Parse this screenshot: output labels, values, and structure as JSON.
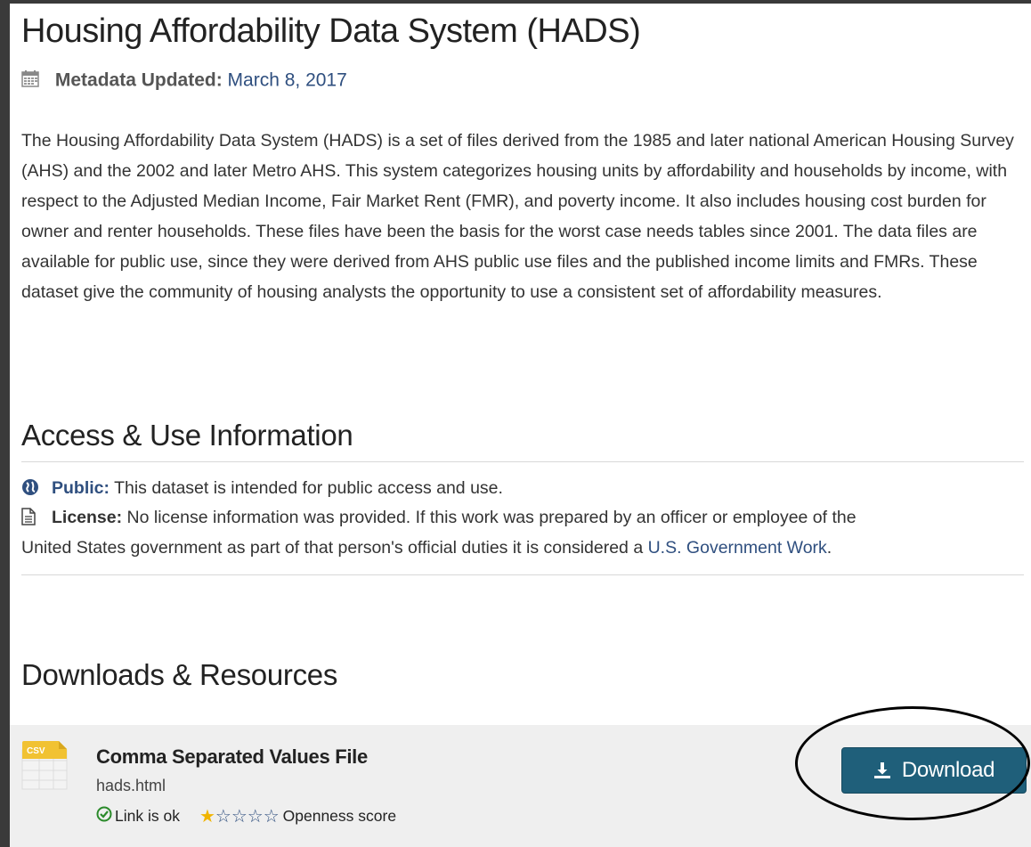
{
  "page": {
    "title": "Housing Affordability Data System (HADS)",
    "metadata_label": "Metadata Updated:",
    "metadata_date": "March 8, 2017",
    "description": "The Housing Affordability Data System (HADS) is a set of files derived from the 1985 and later national American Housing Survey (AHS) and the 2002 and later Metro AHS. This system categorizes housing units by affordability and households by income, with respect to the Adjusted Median Income, Fair Market Rent (FMR), and poverty income. It also includes housing cost burden for owner and renter households. These files have been the basis for the worst case needs tables since 2001. The data files are available for public use, since they were derived from AHS public use files and the published income limits and FMRs. These dataset give the community of housing analysts the opportunity to use a consistent set of affordability measures."
  },
  "access": {
    "heading": "Access & Use Information",
    "public_label": "Public:",
    "public_text": "This dataset is intended for public access and use.",
    "license_label": "License:",
    "license_text_1": "No license information was provided. If this work was prepared by an officer or employee of the",
    "license_text_2": "United States government as part of that person's official duties it is considered a",
    "license_link": "U.S. Government Work",
    "license_period": "."
  },
  "downloads": {
    "heading": "Downloads & Resources",
    "resource": {
      "icon_label": "CSV",
      "title": "Comma Separated Values File",
      "filename": "hads.html",
      "link_status": "Link is ok",
      "openness_score": 1,
      "openness_max": 5,
      "openness_label": "Openness score",
      "button_label": "Download"
    }
  },
  "colors": {
    "link": "#2f4f7f",
    "button": "#1f5f7a",
    "star": "#f0b400",
    "ok": "#2a8a2a"
  },
  "icons": [
    "calendar-icon",
    "globe-icon",
    "document-icon",
    "csv-file-icon",
    "check-circle-icon",
    "star-icon",
    "download-icon"
  ]
}
